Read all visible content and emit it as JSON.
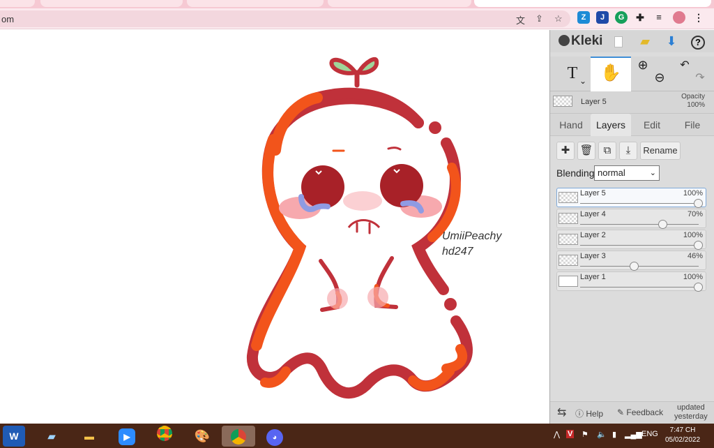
{
  "browser": {
    "url_fragment": "om",
    "icons": [
      "translate-icon",
      "share-icon",
      "bookmark-star-icon",
      "extension-icons",
      "puzzle-icon",
      "reading-list-icon",
      "profile-avatar",
      "menu-kebab-icon"
    ]
  },
  "canvas": {
    "watermark_line1": "UmiiPeachy",
    "watermark_line2": "hd247"
  },
  "panel": {
    "app_name": "Kleki",
    "current_layer_name": "Layer 5",
    "opacity_label": "Opacity",
    "opacity_value": "100%",
    "tools": [
      "text-tool",
      "hand-tool",
      "zoom-tool",
      "undo-redo"
    ],
    "tabs": [
      {
        "label": "Hand",
        "active": false
      },
      {
        "label": "Layers",
        "active": true
      },
      {
        "label": "Edit",
        "active": false
      },
      {
        "label": "File",
        "active": false
      }
    ],
    "rename_label": "Rename",
    "blending_label": "Blending",
    "blending_value": "normal",
    "layers": [
      {
        "name": "Layer 5",
        "opacity": "100%",
        "level": 1.0,
        "selected": true
      },
      {
        "name": "Layer 4",
        "opacity": "70%",
        "level": 0.7,
        "selected": false
      },
      {
        "name": "Layer 2",
        "opacity": "100%",
        "level": 1.0,
        "selected": false
      },
      {
        "name": "Layer 3",
        "opacity": "46%",
        "level": 0.46,
        "selected": false
      },
      {
        "name": "Layer 1",
        "opacity": "100%",
        "level": 1.0,
        "selected": false
      }
    ],
    "footer": {
      "help": "Help",
      "feedback": "Feedback",
      "updated_line1": "updated",
      "updated_line2": "yesterday"
    }
  },
  "taskbar": {
    "apps": [
      "word",
      "notes",
      "file-explorer",
      "zoom",
      "chrome",
      "paint",
      "chrome-active",
      "discord"
    ],
    "language": "ENG",
    "time": "7:47 CH",
    "date": "05/02/2022"
  },
  "colors": {
    "ghost_dark": "#c0313a",
    "ghost_orange": "#f2541b",
    "sprout_leaf": "#9fd49a",
    "blush": "#f7a9ae",
    "tear": "#8f9be3",
    "panel_bg": "#dcdcdc",
    "taskbar_bg": "#4a2616"
  }
}
